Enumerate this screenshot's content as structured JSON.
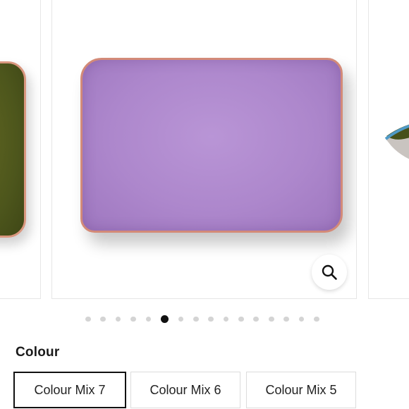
{
  "gallery": {
    "slides": [
      {
        "name": "Colour Mix 7",
        "pillow_color": "#ad87cc",
        "piping_color": "#d38a78"
      },
      {
        "name": "Colour Mix 6",
        "pillow_color": "#4d561c",
        "piping_color": "#d9977f"
      },
      {
        "name": "Colour Mix 5",
        "pillow_color": "#3f4716",
        "piping_color": "#4f9ac7"
      }
    ],
    "zoom_icon": "search-icon",
    "dot_count": 16,
    "active_dot": 5
  },
  "colour": {
    "label": "Colour",
    "options": [
      {
        "label": "Colour Mix 7",
        "selected": true
      },
      {
        "label": "Colour Mix 6",
        "selected": false
      },
      {
        "label": "Colour Mix 5",
        "selected": false
      }
    ]
  }
}
